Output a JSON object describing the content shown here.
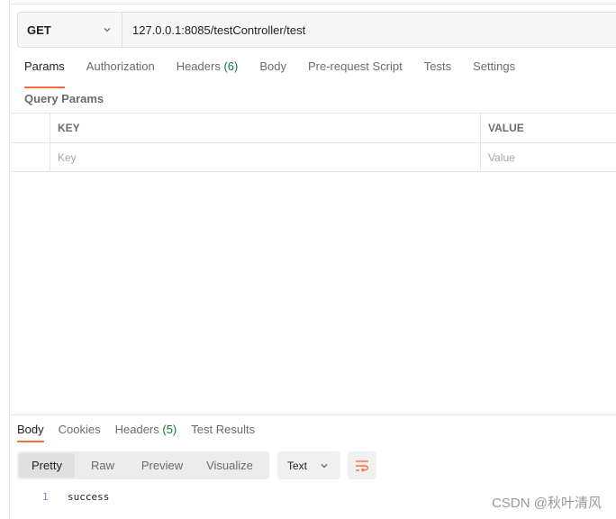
{
  "request": {
    "method": "GET",
    "url": "127.0.0.1:8085/testController/test"
  },
  "request_tabs": [
    {
      "label": "Params",
      "count": ""
    },
    {
      "label": "Authorization",
      "count": ""
    },
    {
      "label": "Headers",
      "count": "(6)"
    },
    {
      "label": "Body",
      "count": ""
    },
    {
      "label": "Pre-request Script",
      "count": ""
    },
    {
      "label": "Tests",
      "count": ""
    },
    {
      "label": "Settings",
      "count": ""
    }
  ],
  "query_params": {
    "title": "Query Params",
    "columns": [
      "KEY",
      "VALUE"
    ],
    "placeholders": {
      "key": "Key",
      "value": "Value"
    }
  },
  "response_tabs": [
    {
      "label": "Body",
      "count": ""
    },
    {
      "label": "Cookies",
      "count": ""
    },
    {
      "label": "Headers",
      "count": "(5)"
    },
    {
      "label": "Test Results",
      "count": ""
    }
  ],
  "view_modes": [
    "Pretty",
    "Raw",
    "Preview",
    "Visualize"
  ],
  "format": {
    "selected": "Text"
  },
  "response_body": [
    {
      "line": "1",
      "text": "success"
    }
  ],
  "watermark": "CSDN @秋叶清风",
  "colors": {
    "accent": "#ff6c37",
    "count": "#0f7a3b"
  }
}
